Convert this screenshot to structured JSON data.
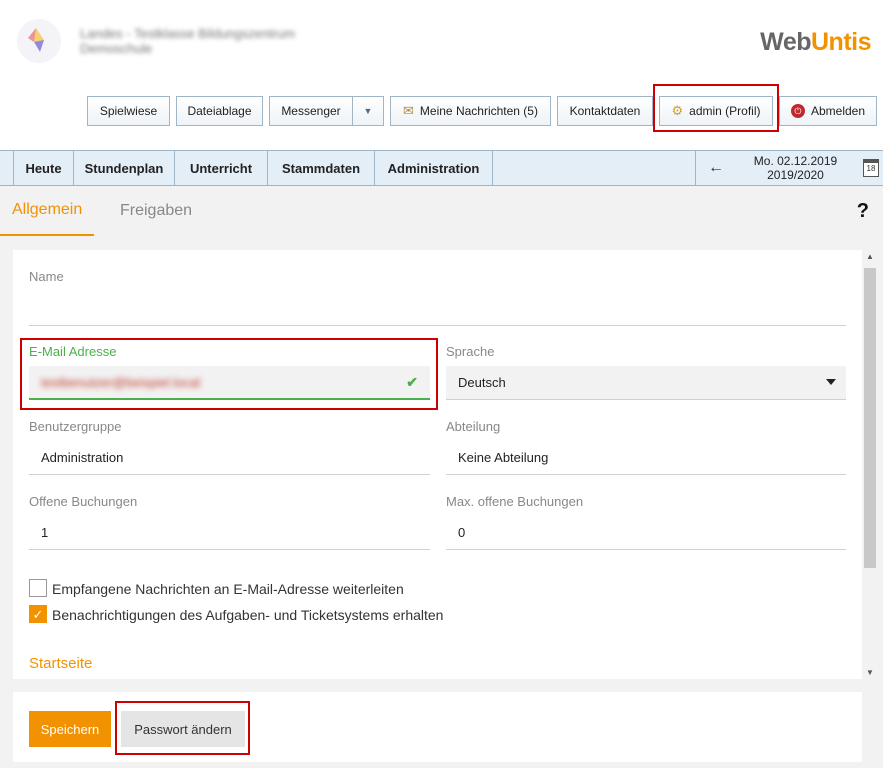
{
  "header": {
    "school_line1": "Landes - Testklasse Bildungszentrum",
    "school_line2": "Demoschule",
    "brand_web": "Web",
    "brand_untis": "Untis"
  },
  "toolbar": {
    "spielwiese": "Spielwiese",
    "dateiablage": "Dateiablage",
    "messenger": "Messenger",
    "meine_nachrichten": "Meine Nachrichten (5)",
    "kontaktdaten": "Kontaktdaten",
    "profil": "admin (Profil)",
    "abmelden": "Abmelden"
  },
  "nav": {
    "items": [
      "Heute",
      "Stundenplan",
      "Unterricht",
      "Stammdaten",
      "Administration"
    ],
    "date": "Mo. 02.12.2019",
    "year": "2019/2020",
    "calendar_day": "18"
  },
  "tabs": {
    "allgemein": "Allgemein",
    "freigaben": "Freigaben",
    "help": "?"
  },
  "form": {
    "name_label": "Name",
    "name_value": "",
    "email_label": "E-Mail Adresse",
    "email_value": "testbenutzer@beispiel.local",
    "sprache_label": "Sprache",
    "sprache_value": "Deutsch",
    "benutzergruppe_label": "Benutzergruppe",
    "benutzergruppe_value": "Administration",
    "abteilung_label": "Abteilung",
    "abteilung_value": "Keine Abteilung",
    "offene_label": "Offene Buchungen",
    "offene_value": "1",
    "max_offene_label": "Max. offene Buchungen",
    "max_offene_value": "0",
    "cb1_label": "Empfangene Nachrichten an E-Mail-Adresse weiterleiten",
    "cb1_checked": false,
    "cb2_label": "Benachrichtigungen des Aufgaben- und Ticketsystems erhalten",
    "cb2_checked": true,
    "startseite_label": "Startseite"
  },
  "footer": {
    "speichern": "Speichern",
    "passwort": "Passwort ändern"
  },
  "colors": {
    "accent": "#f39200",
    "valid": "#4cae4c",
    "highlight": "#cc0000",
    "navbar": "#e3eef7"
  }
}
